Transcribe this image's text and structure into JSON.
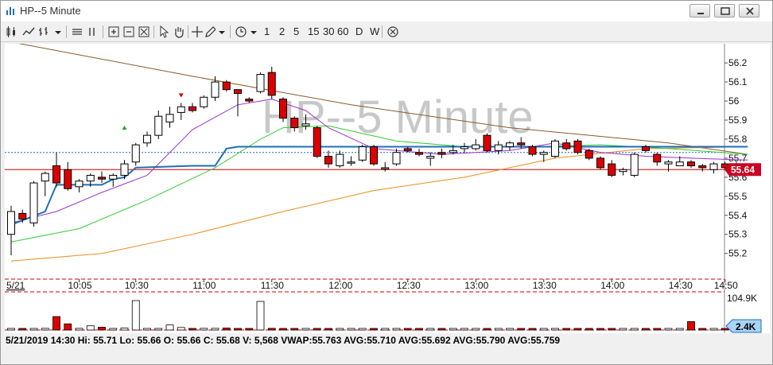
{
  "window": {
    "title": "HP--5 Minute"
  },
  "toolbar": {
    "intervals": [
      "1",
      "2",
      "5",
      "15",
      "30",
      "60",
      "D",
      "W"
    ]
  },
  "chart_data": {
    "type": "candlestick",
    "watermark": "HP--5 Minute",
    "date_label": "5/21",
    "x_tick_labels": [
      "10:05",
      "10:30",
      "11:00",
      "11:30",
      "12:00",
      "12:30",
      "13:00",
      "13:30",
      "14:00",
      "14:30",
      "14:50"
    ],
    "y_tick_labels": [
      "56.2",
      "56.1",
      "56",
      "55.9",
      "55.8",
      "55.7",
      "55.6",
      "55.5",
      "55.4",
      "55.3",
      "55.2"
    ],
    "ylim": [
      55.15,
      56.25
    ],
    "current_price": {
      "label": "55.64",
      "value": 55.64,
      "color": "#cc0022"
    },
    "dotted_level": 55.73,
    "candles": [
      {
        "t": "09:35",
        "o": 55.3,
        "h": 55.45,
        "l": 55.19,
        "c": 55.42
      },
      {
        "t": "09:40",
        "o": 55.41,
        "h": 55.43,
        "l": 55.36,
        "c": 55.38
      },
      {
        "t": "09:45",
        "o": 55.36,
        "h": 55.58,
        "l": 55.34,
        "c": 55.57
      },
      {
        "t": "09:50",
        "o": 55.58,
        "h": 55.63,
        "l": 55.5,
        "c": 55.62
      },
      {
        "t": "09:55",
        "o": 55.66,
        "h": 55.73,
        "l": 55.55,
        "c": 55.57
      },
      {
        "t": "10:00",
        "o": 55.64,
        "h": 55.68,
        "l": 55.53,
        "c": 55.54
      },
      {
        "t": "10:05",
        "o": 55.55,
        "h": 55.59,
        "l": 55.52,
        "c": 55.58
      },
      {
        "t": "10:10",
        "o": 55.58,
        "h": 55.62,
        "l": 55.55,
        "c": 55.61
      },
      {
        "t": "10:15",
        "o": 55.6,
        "h": 55.63,
        "l": 55.57,
        "c": 55.59
      },
      {
        "t": "10:20",
        "o": 55.59,
        "h": 55.62,
        "l": 55.55,
        "c": 55.61
      },
      {
        "t": "10:25",
        "o": 55.61,
        "h": 55.69,
        "l": 55.59,
        "c": 55.67
      },
      {
        "t": "10:30",
        "o": 55.68,
        "h": 55.78,
        "l": 55.66,
        "c": 55.77
      },
      {
        "t": "10:35",
        "o": 55.78,
        "h": 55.84,
        "l": 55.76,
        "c": 55.82
      },
      {
        "t": "10:40",
        "o": 55.82,
        "h": 55.95,
        "l": 55.8,
        "c": 55.92
      },
      {
        "t": "10:45",
        "o": 55.89,
        "h": 55.97,
        "l": 55.86,
        "c": 55.93
      },
      {
        "t": "10:50",
        "o": 55.94,
        "h": 55.99,
        "l": 55.9,
        "c": 55.97
      },
      {
        "t": "10:55",
        "o": 55.97,
        "h": 55.99,
        "l": 55.94,
        "c": 55.95
      },
      {
        "t": "11:00",
        "o": 55.97,
        "h": 56.03,
        "l": 55.96,
        "c": 56.02
      },
      {
        "t": "11:05",
        "o": 56.02,
        "h": 56.13,
        "l": 56.0,
        "c": 56.1
      },
      {
        "t": "11:10",
        "o": 56.1,
        "h": 56.11,
        "l": 56.05,
        "c": 56.06
      },
      {
        "t": "11:15",
        "o": 56.06,
        "h": 56.06,
        "l": 55.92,
        "c": 56.04
      },
      {
        "t": "11:20",
        "o": 56.01,
        "h": 56.02,
        "l": 55.99,
        "c": 56.0
      },
      {
        "t": "11:25",
        "o": 56.05,
        "h": 56.15,
        "l": 56.04,
        "c": 56.14
      },
      {
        "t": "11:30",
        "o": 56.15,
        "h": 56.18,
        "l": 56.01,
        "c": 56.03
      },
      {
        "t": "11:35",
        "o": 56.01,
        "h": 56.02,
        "l": 55.89,
        "c": 55.91
      },
      {
        "t": "11:40",
        "o": 55.91,
        "h": 55.92,
        "l": 55.84,
        "c": 55.86
      },
      {
        "t": "11:45",
        "o": 55.87,
        "h": 55.93,
        "l": 55.85,
        "c": 55.88
      },
      {
        "t": "11:50",
        "o": 55.86,
        "h": 55.87,
        "l": 55.7,
        "c": 55.71
      },
      {
        "t": "11:55",
        "o": 55.71,
        "h": 55.74,
        "l": 55.65,
        "c": 55.67
      },
      {
        "t": "12:00",
        "o": 55.66,
        "h": 55.74,
        "l": 55.65,
        "c": 55.72
      },
      {
        "t": "12:05",
        "o": 55.68,
        "h": 55.71,
        "l": 55.66,
        "c": 55.68
      },
      {
        "t": "12:10",
        "o": 55.69,
        "h": 55.77,
        "l": 55.68,
        "c": 55.76
      },
      {
        "t": "12:15",
        "o": 55.76,
        "h": 55.77,
        "l": 55.66,
        "c": 55.67
      },
      {
        "t": "12:20",
        "o": 55.65,
        "h": 55.68,
        "l": 55.63,
        "c": 55.65
      },
      {
        "t": "12:25",
        "o": 55.67,
        "h": 55.75,
        "l": 55.66,
        "c": 55.73
      },
      {
        "t": "12:30",
        "o": 55.75,
        "h": 55.76,
        "l": 55.73,
        "c": 55.74
      },
      {
        "t": "12:35",
        "o": 55.73,
        "h": 55.75,
        "l": 55.71,
        "c": 55.72
      },
      {
        "t": "12:40",
        "o": 55.7,
        "h": 55.73,
        "l": 55.66,
        "c": 55.71
      },
      {
        "t": "12:45",
        "o": 55.73,
        "h": 55.75,
        "l": 55.7,
        "c": 55.72
      },
      {
        "t": "12:50",
        "o": 55.73,
        "h": 55.77,
        "l": 55.72,
        "c": 55.74
      },
      {
        "t": "12:55",
        "o": 55.75,
        "h": 55.78,
        "l": 55.73,
        "c": 55.76
      },
      {
        "t": "13:00",
        "o": 55.75,
        "h": 55.8,
        "l": 55.74,
        "c": 55.77
      },
      {
        "t": "13:05",
        "o": 55.82,
        "h": 55.83,
        "l": 55.73,
        "c": 55.74
      },
      {
        "t": "13:10",
        "o": 55.74,
        "h": 55.79,
        "l": 55.72,
        "c": 55.77
      },
      {
        "t": "13:15",
        "o": 55.76,
        "h": 55.79,
        "l": 55.74,
        "c": 55.78
      },
      {
        "t": "13:20",
        "o": 55.78,
        "h": 55.81,
        "l": 55.75,
        "c": 55.77
      },
      {
        "t": "13:25",
        "o": 55.76,
        "h": 55.77,
        "l": 55.71,
        "c": 55.72
      },
      {
        "t": "13:30",
        "o": 55.72,
        "h": 55.74,
        "l": 55.68,
        "c": 55.73
      },
      {
        "t": "13:35",
        "o": 55.71,
        "h": 55.8,
        "l": 55.7,
        "c": 55.79
      },
      {
        "t": "13:40",
        "o": 55.78,
        "h": 55.8,
        "l": 55.74,
        "c": 55.75
      },
      {
        "t": "13:45",
        "o": 55.79,
        "h": 55.8,
        "l": 55.72,
        "c": 55.73
      },
      {
        "t": "13:50",
        "o": 55.74,
        "h": 55.75,
        "l": 55.69,
        "c": 55.7
      },
      {
        "t": "13:55",
        "o": 55.7,
        "h": 55.71,
        "l": 55.64,
        "c": 55.65
      },
      {
        "t": "14:00",
        "o": 55.67,
        "h": 55.69,
        "l": 55.6,
        "c": 55.61
      },
      {
        "t": "14:05",
        "o": 55.63,
        "h": 55.65,
        "l": 55.61,
        "c": 55.64
      },
      {
        "t": "14:10",
        "o": 55.61,
        "h": 55.73,
        "l": 55.6,
        "c": 55.72
      },
      {
        "t": "14:15",
        "o": 55.76,
        "h": 55.77,
        "l": 55.73,
        "c": 55.74
      },
      {
        "t": "14:20",
        "o": 55.72,
        "h": 55.73,
        "l": 55.66,
        "c": 55.68
      },
      {
        "t": "14:25",
        "o": 55.67,
        "h": 55.69,
        "l": 55.63,
        "c": 55.68
      },
      {
        "t": "14:30",
        "o": 55.66,
        "h": 55.71,
        "l": 55.66,
        "c": 55.68
      },
      {
        "t": "14:35",
        "o": 55.68,
        "h": 55.69,
        "l": 55.65,
        "c": 55.66
      },
      {
        "t": "14:40",
        "o": 55.66,
        "h": 55.67,
        "l": 55.63,
        "c": 55.65
      },
      {
        "t": "14:45",
        "o": 55.64,
        "h": 55.68,
        "l": 55.62,
        "c": 55.67
      },
      {
        "t": "14:50",
        "o": 55.67,
        "h": 55.68,
        "l": 55.64,
        "c": 55.65
      },
      {
        "t": "14:55",
        "o": 55.67,
        "h": 55.68,
        "l": 55.64,
        "c": 55.66
      },
      {
        "t": "15:00",
        "o": 55.66,
        "h": 55.67,
        "l": 55.62,
        "c": 55.64
      }
    ],
    "moving_averages": [
      {
        "color": "#8a5a2b",
        "values": [
          [
            0,
            56.31
          ],
          [
            16,
            56.13
          ],
          [
            30,
            55.98
          ],
          [
            44,
            55.86
          ],
          [
            58,
            55.78
          ],
          [
            65,
            55.72
          ]
        ]
      },
      {
        "color": "#f08a1c",
        "values": [
          [
            0,
            55.16
          ],
          [
            8,
            55.2
          ],
          [
            16,
            55.3
          ],
          [
            24,
            55.42
          ],
          [
            32,
            55.53
          ],
          [
            40,
            55.6
          ],
          [
            48,
            55.7
          ],
          [
            56,
            55.75
          ],
          [
            65,
            55.76
          ]
        ]
      },
      {
        "color": "#33cc33",
        "values": [
          [
            0,
            55.26
          ],
          [
            6,
            55.33
          ],
          [
            12,
            55.48
          ],
          [
            18,
            55.65
          ],
          [
            22,
            55.8
          ],
          [
            24,
            55.86
          ],
          [
            28,
            55.87
          ],
          [
            34,
            55.79
          ],
          [
            40,
            55.76
          ],
          [
            46,
            55.76
          ],
          [
            52,
            55.77
          ],
          [
            58,
            55.75
          ],
          [
            65,
            55.72
          ]
        ]
      },
      {
        "color": "#9933cc",
        "values": [
          [
            0,
            55.36
          ],
          [
            4,
            55.42
          ],
          [
            8,
            55.52
          ],
          [
            12,
            55.61
          ],
          [
            16,
            55.85
          ],
          [
            20,
            55.98
          ],
          [
            23,
            56.01
          ],
          [
            26,
            55.95
          ],
          [
            28,
            55.86
          ],
          [
            32,
            55.75
          ],
          [
            38,
            55.72
          ],
          [
            44,
            55.74
          ],
          [
            48,
            55.78
          ],
          [
            52,
            55.73
          ],
          [
            56,
            55.71
          ],
          [
            60,
            55.7
          ],
          [
            65,
            55.69
          ]
        ]
      },
      {
        "color": "#1f6fb5",
        "values": [
          [
            0,
            55.35
          ],
          [
            3,
            55.42
          ],
          [
            4,
            55.56
          ],
          [
            8,
            55.56
          ],
          [
            9,
            55.59
          ],
          [
            10,
            55.6
          ],
          [
            11,
            55.65
          ],
          [
            16,
            55.66
          ],
          [
            18,
            55.66
          ],
          [
            19,
            55.75
          ],
          [
            20,
            55.76
          ],
          [
            65,
            55.76
          ]
        ]
      }
    ],
    "volume": {
      "axis_labels": [
        "104.9K"
      ],
      "current_label": "2.4K",
      "max": 104900,
      "values": [
        4000,
        5000,
        3000,
        6000,
        48000,
        22000,
        6000,
        15000,
        10000,
        4000,
        7000,
        104900,
        5000,
        4000,
        18000,
        9000,
        5000,
        6000,
        6000,
        7000,
        4000,
        4000,
        102000,
        6000,
        5000,
        4000,
        3000,
        3000,
        3000,
        4000,
        3000,
        3000,
        3000,
        3000,
        3000,
        3000,
        3000,
        3000,
        3000,
        3000,
        3000,
        3000,
        3000,
        3000,
        3000,
        3000,
        3000,
        3000,
        3000,
        3000,
        3000,
        3000,
        3000,
        3000,
        3000,
        3000,
        3000,
        3000,
        3000,
        3000,
        30000,
        4000,
        4000,
        3000,
        3000,
        3000,
        3000,
        2400
      ]
    },
    "status_line": "5/21/2019 14:30  Hi: 55.71  Lo: 55.66  O: 55.66  C: 55.68  V: 5,568  VWAP:55.763  AVG:55.710  AVG:55.692  AVG:55.790  AVG:55.759"
  },
  "colors": {
    "up_fill": "#ffffff",
    "down_fill": "#dd0000",
    "grid_dash": "#cc0000"
  }
}
